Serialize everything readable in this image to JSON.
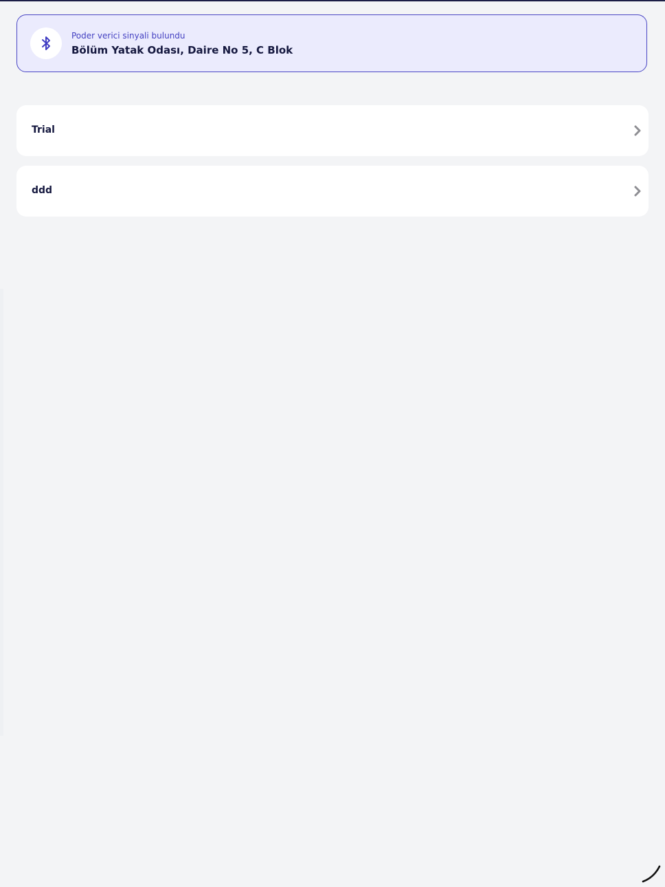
{
  "beacon": {
    "icon": "bluetooth-icon",
    "subtitle": "Poder verici sinyali bulundu",
    "title": "Bölüm Yatak Odası, Daire No 5, C Blok"
  },
  "items": [
    {
      "label": "Trial",
      "icon": "chevron-right-icon"
    },
    {
      "label": "ddd",
      "icon": "chevron-right-icon"
    }
  ],
  "colors": {
    "accent": "#4a47c4",
    "banner_bg": "#ebebfd",
    "page_bg": "#f3f4f6",
    "text": "#15183f"
  }
}
